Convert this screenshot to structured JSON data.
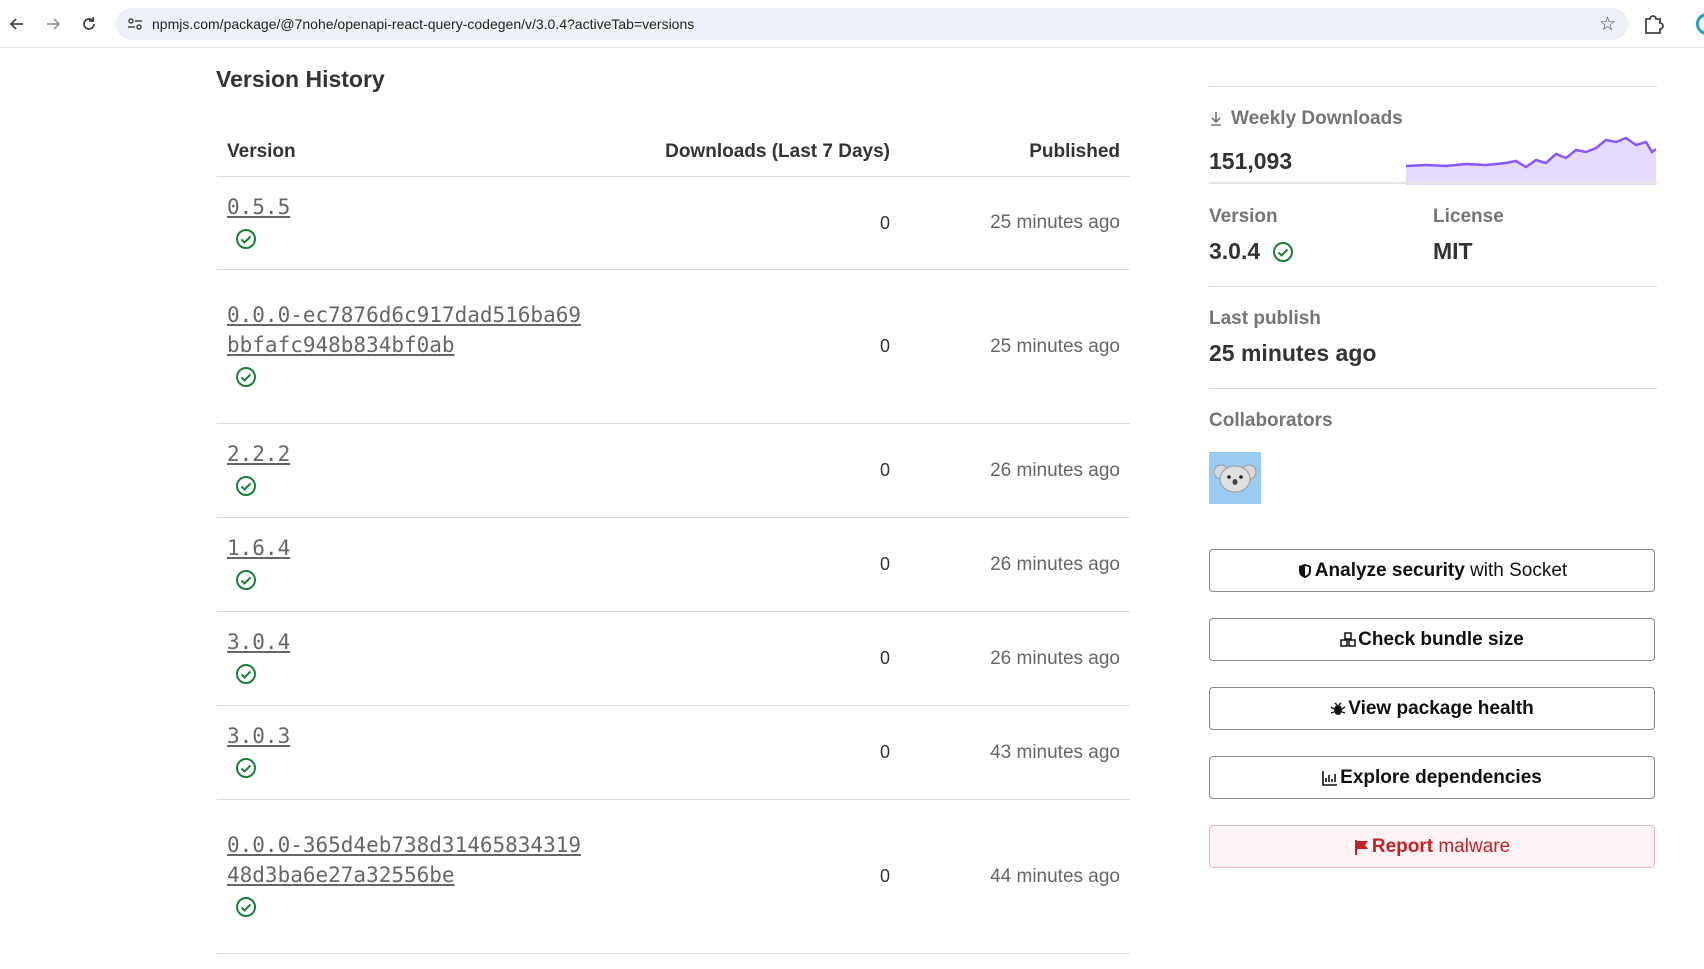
{
  "browser": {
    "url": "npmjs.com/package/@7nohe/openapi-react-query-codegen/v/3.0.4?activeTab=versions",
    "back_icon": "arrow-left-icon",
    "forward_icon": "arrow-right-icon",
    "reload_icon": "reload-icon",
    "star_icon": "star-icon",
    "extensions_icon": "puzzle-icon"
  },
  "main": {
    "title": "Version History",
    "columns": [
      "Version",
      "Downloads (Last 7 Days)",
      "Published"
    ],
    "rows": [
      {
        "version": "0.5.5",
        "downloads": "0",
        "published": "25 minutes ago"
      },
      {
        "version": "0.0.0-ec7876d6c917dad516ba69bbfafc948b834bf0ab",
        "downloads": "0",
        "published": "25 minutes ago"
      },
      {
        "version": "2.2.2",
        "downloads": "0",
        "published": "26 minutes ago"
      },
      {
        "version": "1.6.4",
        "downloads": "0",
        "published": "26 minutes ago"
      },
      {
        "version": "3.0.4",
        "downloads": "0",
        "published": "26 minutes ago"
      },
      {
        "version": "3.0.3",
        "downloads": "0",
        "published": "43 minutes ago"
      },
      {
        "version": "0.0.0-365d4eb738d3146583431948d3ba6e27a32556be",
        "downloads": "0",
        "published": "44 minutes ago"
      }
    ]
  },
  "sidebar": {
    "weekly_downloads_label": "Weekly Downloads",
    "weekly_downloads_value": "151,093",
    "version_label": "Version",
    "version_value": "3.0.4",
    "license_label": "License",
    "license_value": "MIT",
    "last_publish_label": "Last publish",
    "last_publish_value": "25 minutes ago",
    "collaborators_label": "Collaborators",
    "sparkline_color": "#8956ff",
    "sparkline_fill": "#e6dbff",
    "buttons": {
      "analyze_strong": "Analyze security",
      "analyze_rest": " with Socket",
      "bundle": "Check bundle size",
      "health": "View package health",
      "deps": "Explore dependencies",
      "report_strong": "Report",
      "report_rest": " malware"
    }
  },
  "colors": {
    "check_green": "#1a7f37",
    "report_red": "#c12127"
  }
}
